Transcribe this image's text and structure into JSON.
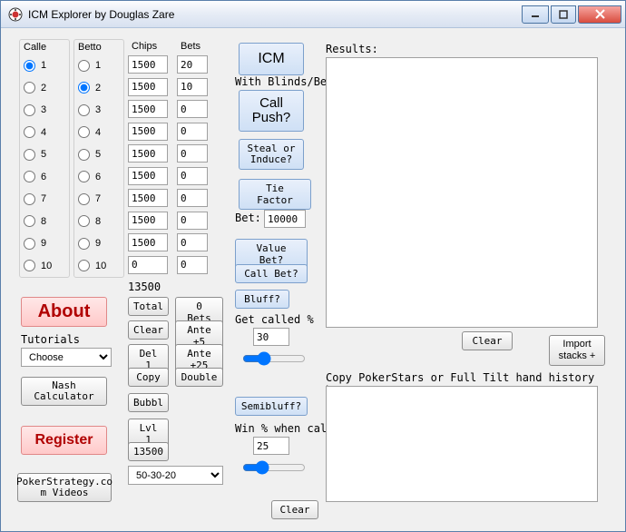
{
  "window": {
    "title": "ICM Explorer by Douglas Zare"
  },
  "headers": {
    "caller": "Calle",
    "bettor": "Betto",
    "chips": "Chips",
    "bets": "Bets"
  },
  "players": [
    {
      "n": "1",
      "chips": "1500",
      "bets": "20"
    },
    {
      "n": "2",
      "chips": "1500",
      "bets": "10"
    },
    {
      "n": "3",
      "chips": "1500",
      "bets": "0"
    },
    {
      "n": "4",
      "chips": "1500",
      "bets": "0"
    },
    {
      "n": "5",
      "chips": "1500",
      "bets": "0"
    },
    {
      "n": "6",
      "chips": "1500",
      "bets": "0"
    },
    {
      "n": "7",
      "chips": "1500",
      "bets": "0"
    },
    {
      "n": "8",
      "chips": "1500",
      "bets": "0"
    },
    {
      "n": "9",
      "chips": "1500",
      "bets": "0"
    },
    {
      "n": "10",
      "chips": "0",
      "bets": "0"
    }
  ],
  "caller_selected": 0,
  "bettor_selected": 1,
  "totals": {
    "chips": "13500"
  },
  "side_buttons": {
    "total": "Total",
    "zero_bets": "0 Bets",
    "clear": "Clear",
    "ante5": "Ante +5",
    "del1": "Del 1",
    "ante25": "Ante +25",
    "copy": "Copy",
    "double": "Double",
    "bubbl": "Bubbl",
    "lvl1": "Lvl 1",
    "stack": "13500"
  },
  "payout_options": [
    "50-30-20"
  ],
  "payout_selected": "50-30-20",
  "left_panel": {
    "about": "About",
    "tutorials_label": "Tutorials",
    "tutorials_options": [
      "Choose"
    ],
    "tutorials_selected": "Choose",
    "nash": "Nash\nCalculator",
    "register": "Register",
    "videos": "PokerStrategy.co\nm Videos"
  },
  "mid_panel": {
    "icm": "ICM",
    "with_blinds": "With Blinds/Bets:",
    "call_push": "Call\nPush?",
    "steal": "Steal or\nInduce?",
    "tie": "Tie Factor",
    "bet_label": "Bet:",
    "bet_value": "10000",
    "value_bet": "Value Bet?",
    "call_bet": "Call Bet?",
    "bluff": "Bluff?",
    "get_called_label": "Get called %",
    "get_called_value": "30",
    "semibluff": "Semibluff?",
    "winpct_label": "Win % when called",
    "winpct_value": "25",
    "clear": "Clear"
  },
  "right_panel": {
    "results_label": "Results:",
    "results_text": "",
    "clear": "Clear",
    "import": "Import\nstacks +",
    "copy_hh_label": "Copy PokerStars or Full Tilt hand history here.",
    "hh_text": ""
  }
}
